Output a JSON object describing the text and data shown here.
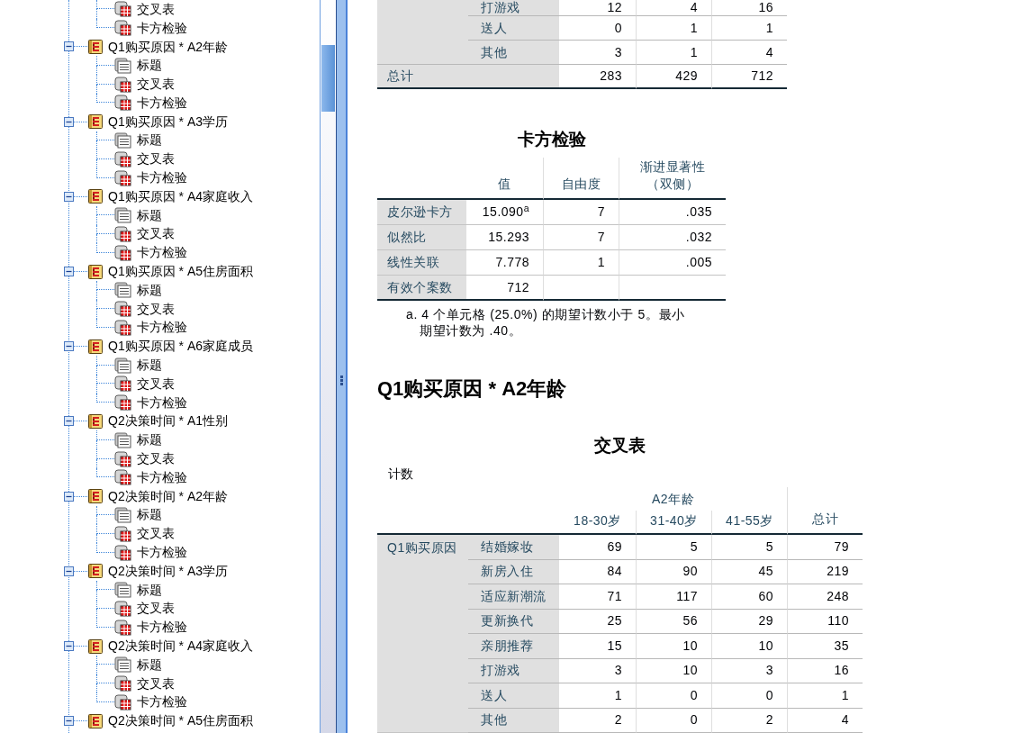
{
  "navigator": {
    "items": [
      {
        "children": [
          {
            "kind": "table",
            "label": "交叉表"
          },
          {
            "kind": "table",
            "label": "卡方检验"
          }
        ]
      },
      {
        "label": "Q1购买原因 * A2年龄",
        "expanded": true,
        "children": [
          {
            "kind": "title",
            "label": "标题"
          },
          {
            "kind": "table",
            "label": "交叉表"
          },
          {
            "kind": "table",
            "label": "卡方检验"
          }
        ]
      },
      {
        "label": "Q1购买原因 * A3学历",
        "expanded": true,
        "children": [
          {
            "kind": "title",
            "label": "标题"
          },
          {
            "kind": "table",
            "label": "交叉表"
          },
          {
            "kind": "table",
            "label": "卡方检验"
          }
        ]
      },
      {
        "label": "Q1购买原因 * A4家庭收入",
        "expanded": true,
        "children": [
          {
            "kind": "title",
            "label": "标题"
          },
          {
            "kind": "table",
            "label": "交叉表"
          },
          {
            "kind": "table",
            "label": "卡方检验"
          }
        ]
      },
      {
        "label": "Q1购买原因 * A5住房面积",
        "expanded": true,
        "children": [
          {
            "kind": "title",
            "label": "标题"
          },
          {
            "kind": "table",
            "label": "交叉表"
          },
          {
            "kind": "table",
            "label": "卡方检验"
          }
        ]
      },
      {
        "label": "Q1购买原因 * A6家庭成员",
        "expanded": true,
        "children": [
          {
            "kind": "title",
            "label": "标题"
          },
          {
            "kind": "table",
            "label": "交叉表"
          },
          {
            "kind": "table",
            "label": "卡方检验"
          }
        ]
      },
      {
        "label": "Q2决策时间 * A1性别",
        "expanded": true,
        "children": [
          {
            "kind": "title",
            "label": "标题"
          },
          {
            "kind": "table",
            "label": "交叉表"
          },
          {
            "kind": "table",
            "label": "卡方检验"
          }
        ]
      },
      {
        "label": "Q2决策时间 * A2年龄",
        "expanded": true,
        "children": [
          {
            "kind": "title",
            "label": "标题"
          },
          {
            "kind": "table",
            "label": "交叉表"
          },
          {
            "kind": "table",
            "label": "卡方检验"
          }
        ]
      },
      {
        "label": "Q2决策时间 * A3学历",
        "expanded": true,
        "children": [
          {
            "kind": "title",
            "label": "标题"
          },
          {
            "kind": "table",
            "label": "交叉表"
          },
          {
            "kind": "table",
            "label": "卡方检验"
          }
        ]
      },
      {
        "label": "Q2决策时间 * A4家庭收入",
        "expanded": true,
        "children": [
          {
            "kind": "title",
            "label": "标题"
          },
          {
            "kind": "table",
            "label": "交叉表"
          },
          {
            "kind": "table",
            "label": "卡方检验"
          }
        ]
      },
      {
        "label": "Q2决策时间 * A5住房面积",
        "expanded": true
      }
    ]
  },
  "output": {
    "crosstab_continued": {
      "rows": [
        {
          "label": "打游戏",
          "values": [
            "12",
            "4",
            "16"
          ]
        },
        {
          "label": "送人",
          "values": [
            "0",
            "1",
            "1"
          ]
        },
        {
          "label": "其他",
          "values": [
            "3",
            "1",
            "4"
          ]
        }
      ],
      "total": {
        "label": "总计",
        "values": [
          "283",
          "429",
          "712"
        ]
      }
    },
    "chi_square_tests": {
      "title": "卡方检验",
      "columns": [
        "值",
        "自由度",
        "渐进显著性（双侧）"
      ],
      "rows": [
        {
          "label": "皮尔逊卡方",
          "values": [
            "15.090$^{a}$",
            "7",
            ".035"
          ]
        },
        {
          "label": "似然比",
          "values": [
            "15.293",
            "7",
            ".032"
          ]
        },
        {
          "label": "线性关联",
          "values": [
            "7.778",
            "1",
            ".005"
          ]
        },
        {
          "label": "有效个案数",
          "values": [
            "712"
          ]
        }
      ],
      "footnote": "a. 4 个单元格 (25.0%) 的期望计数小于 5。最小期望计数为 .40。"
    },
    "heading": "Q1购买原因 * A2年龄",
    "crosstab": {
      "title": "交叉表",
      "statistic": "计数",
      "column_variable": "A2年龄",
      "columns": [
        "18-30岁",
        "31-40岁",
        "41-55岁"
      ],
      "total_column": "总计",
      "row_variable": "Q1购买原因",
      "rows": [
        {
          "label": "结婚嫁妆",
          "values": [
            "69",
            "5",
            "5",
            "79"
          ]
        },
        {
          "label": "新房入住",
          "values": [
            "84",
            "90",
            "45",
            "219"
          ]
        },
        {
          "label": "适应新潮流",
          "values": [
            "71",
            "117",
            "60",
            "248"
          ]
        },
        {
          "label": "更新换代",
          "values": [
            "25",
            "56",
            "29",
            "110"
          ]
        },
        {
          "label": "亲朋推荐",
          "values": [
            "15",
            "10",
            "10",
            "35"
          ]
        },
        {
          "label": "打游戏",
          "values": [
            "3",
            "10",
            "3",
            "16"
          ]
        },
        {
          "label": "送人",
          "values": [
            "1",
            "0",
            "0",
            "1"
          ]
        },
        {
          "label": "其他",
          "values": [
            "2",
            "0",
            "2",
            "4"
          ]
        }
      ]
    }
  }
}
